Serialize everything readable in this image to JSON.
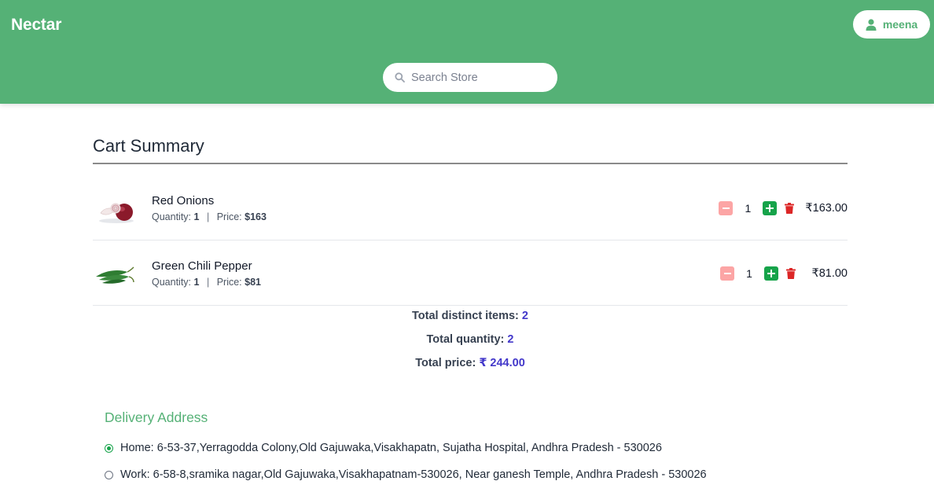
{
  "header": {
    "brand": "Nectar",
    "user_name": "meena",
    "search_placeholder": "Search Store"
  },
  "cart": {
    "title": "Cart Summary",
    "items": [
      {
        "name": "Red Onions",
        "quantity_label": "Quantity:",
        "quantity": "1",
        "price_label": "Price:",
        "price": "$163",
        "stepper_qty": "1",
        "line_total": "₹163.00"
      },
      {
        "name": "Green Chili Pepper",
        "quantity_label": "Quantity:",
        "quantity": "1",
        "price_label": "Price:",
        "price": "$81",
        "stepper_qty": "1",
        "line_total": "₹81.00"
      }
    ],
    "totals": {
      "distinct_label": "Total distinct items:",
      "distinct_value": "2",
      "quantity_label": "Total quantity:",
      "quantity_value": "2",
      "price_label": "Total price:",
      "price_value": "₹ 244.00"
    }
  },
  "delivery": {
    "title": "Delivery Address",
    "addresses": [
      {
        "text": "Home: 6-53-37,Yerragodda Colony,Old Gajuwaka,Visakhapatn, Sujatha Hospital, Andhra Pradesh - 530026",
        "selected": true
      },
      {
        "text": "Work: 6-58-8,sramika nagar,Old Gajuwaka,Visakhapatnam-530026, Near ganesh Temple, Andhra Pradesh - 530026",
        "selected": false
      }
    ]
  },
  "colors": {
    "brand_green": "#55b176",
    "accent_indigo": "#4338ca",
    "plus_green": "#16a34a",
    "minus_pink": "#fca5a5",
    "trash_red": "#dc2626"
  },
  "icons": [
    "user-icon",
    "search-icon",
    "minus-icon",
    "plus-icon",
    "trash-icon",
    "radio-icon"
  ]
}
